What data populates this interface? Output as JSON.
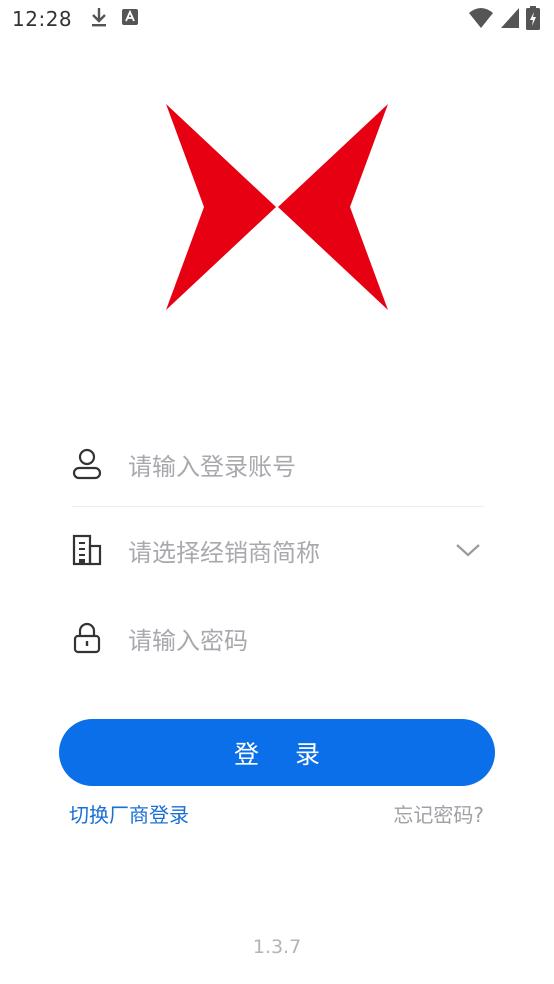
{
  "status_bar": {
    "time": "12:28",
    "icons": [
      "download-icon",
      "a-badge-icon",
      "wifi-icon",
      "signal-icon",
      "battery-charging-icon"
    ]
  },
  "logo": {
    "name": "red-x-bowtie-logo",
    "color": "#e60012"
  },
  "form": {
    "account_placeholder": "请输入登录账号",
    "dealer_placeholder": "请选择经销商简称",
    "password_placeholder": "请输入密码"
  },
  "actions": {
    "login_label": "登 录",
    "switch_label": "切换厂商登录",
    "forgot_label": "忘记密码?"
  },
  "footer": {
    "version": "1.3.7"
  },
  "colors": {
    "primary": "#0a6fe8",
    "link": "#1a6fd6",
    "placeholder": "#a8a8ae",
    "logo_red": "#e60012"
  }
}
